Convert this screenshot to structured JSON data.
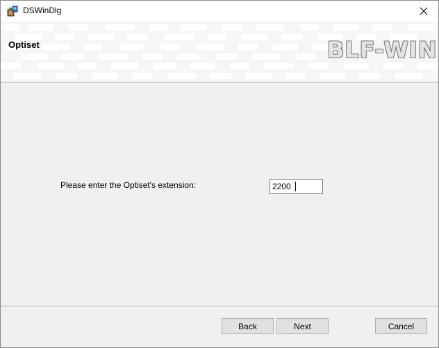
{
  "window": {
    "title": "DSWinDlg",
    "close_glyph": "✕"
  },
  "banner": {
    "title": "Optiset",
    "logo_text": "BLF-WIN"
  },
  "form": {
    "prompt": "Please enter the Optiset's extension:",
    "extension_value": "2200"
  },
  "buttons": {
    "back": "Back",
    "next": "Next",
    "cancel": "Cancel"
  },
  "icons": {
    "app": "installer-icon",
    "close": "close-icon"
  },
  "colors": {
    "window_bg": "#f0f0f0",
    "banner_bg": "#f6f6f6",
    "button_bg": "#e1e1e1",
    "button_border": "#adadad",
    "logo_fill": "#e4e4e4",
    "logo_outline": "#7c7c7c"
  }
}
